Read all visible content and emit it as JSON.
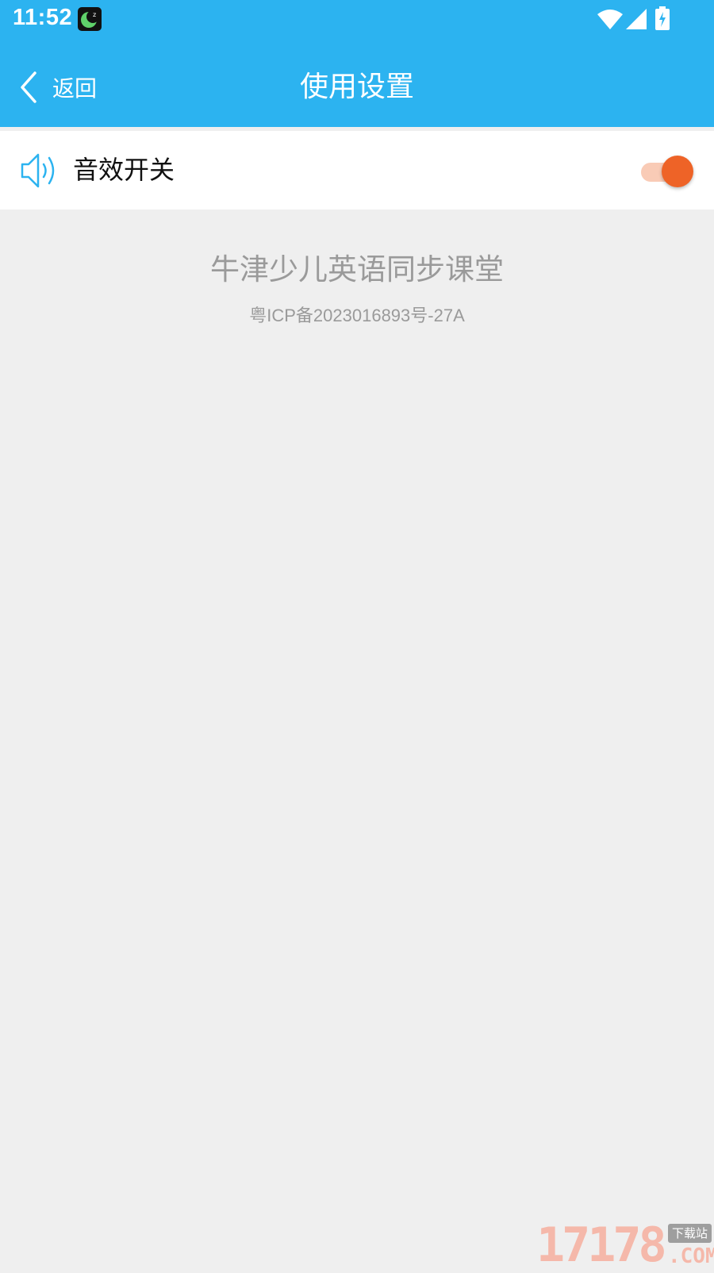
{
  "status_bar": {
    "time": "11:52",
    "icons": [
      "app-notification-icon",
      "wifi-icon",
      "cell-signal-icon",
      "battery-charging-icon"
    ]
  },
  "nav": {
    "back_label": "返回",
    "title": "使用设置"
  },
  "settings": [
    {
      "icon": "speaker-icon",
      "label": "音效开关",
      "toggle_on": true
    }
  ],
  "footer": {
    "app_name": "牛津少儿英语同步课堂",
    "icp": "粤ICP备2023016893号-27A"
  },
  "watermark": {
    "digits": "17178",
    "badge": "下载站",
    "suffix": ".COM"
  },
  "colors": {
    "header": "#2cb3f0",
    "background": "#efefef",
    "toggle_thumb": "#ee6327",
    "toggle_track": "#f9cbb6",
    "muted_text": "#9a9a9a"
  }
}
